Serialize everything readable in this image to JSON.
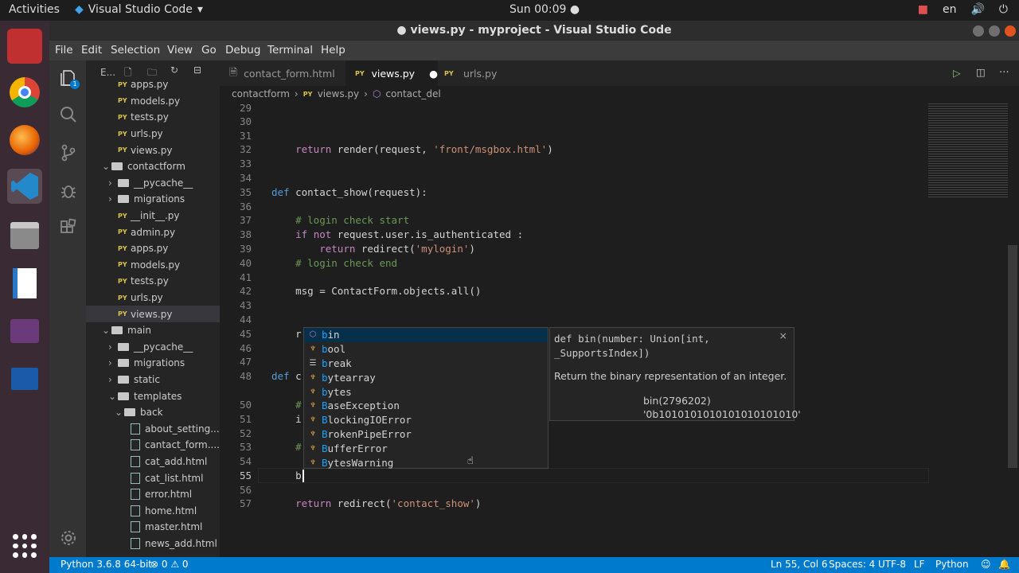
{
  "topbar": {
    "activities": "Activities",
    "app": "Visual Studio Code",
    "clock": "Sun 00:09",
    "lang": "en"
  },
  "window": {
    "title": "● views.py - myproject - Visual Studio Code"
  },
  "menu": [
    "File",
    "Edit",
    "Selection",
    "View",
    "Go",
    "Debug",
    "Terminal",
    "Help"
  ],
  "explorer": {
    "label": "E..."
  },
  "tree": [
    {
      "name": "apps.py",
      "kind": "py",
      "indent": 40
    },
    {
      "name": "models.py",
      "kind": "py",
      "indent": 40
    },
    {
      "name": "tests.py",
      "kind": "py",
      "indent": 40
    },
    {
      "name": "urls.py",
      "kind": "py",
      "indent": 40
    },
    {
      "name": "views.py",
      "kind": "py",
      "indent": 40
    },
    {
      "name": "contactform",
      "kind": "folder-open",
      "indent": 20
    },
    {
      "name": "__pycache__",
      "kind": "folder",
      "indent": 28
    },
    {
      "name": "migrations",
      "kind": "folder",
      "indent": 28
    },
    {
      "name": "__init__.py",
      "kind": "py",
      "indent": 40
    },
    {
      "name": "admin.py",
      "kind": "py",
      "indent": 40
    },
    {
      "name": "apps.py",
      "kind": "py",
      "indent": 40
    },
    {
      "name": "models.py",
      "kind": "py",
      "indent": 40
    },
    {
      "name": "tests.py",
      "kind": "py",
      "indent": 40
    },
    {
      "name": "urls.py",
      "kind": "py",
      "indent": 40
    },
    {
      "name": "views.py",
      "kind": "py",
      "indent": 40,
      "selected": true
    },
    {
      "name": "main",
      "kind": "folder-open",
      "indent": 20
    },
    {
      "name": "__pycache__",
      "kind": "folder",
      "indent": 28
    },
    {
      "name": "migrations",
      "kind": "folder",
      "indent": 28
    },
    {
      "name": "static",
      "kind": "folder",
      "indent": 28
    },
    {
      "name": "templates",
      "kind": "folder-open",
      "indent": 28
    },
    {
      "name": "back",
      "kind": "folder-open",
      "indent": 36
    },
    {
      "name": "about_setting...",
      "kind": "html",
      "indent": 56
    },
    {
      "name": "cantact_form....",
      "kind": "html",
      "indent": 56
    },
    {
      "name": "cat_add.html",
      "kind": "html",
      "indent": 56
    },
    {
      "name": "cat_list.html",
      "kind": "html",
      "indent": 56
    },
    {
      "name": "error.html",
      "kind": "html",
      "indent": 56
    },
    {
      "name": "home.html",
      "kind": "html",
      "indent": 56
    },
    {
      "name": "master.html",
      "kind": "html",
      "indent": 56
    },
    {
      "name": "news_add.html",
      "kind": "html",
      "indent": 56
    }
  ],
  "tabs": [
    {
      "label": "contact_form.html",
      "icon": "html-file-icon",
      "active": false
    },
    {
      "label": "views.py",
      "icon": "PY",
      "active": true,
      "dirty": "●"
    },
    {
      "label": "urls.py",
      "icon": "PY",
      "active": false
    }
  ],
  "breadcrumbs": {
    "folder": "contactform",
    "file": "views.py",
    "symbol": "contact_del"
  },
  "code": [
    {
      "n": "29",
      "t": ""
    },
    {
      "n": "30",
      "t": ""
    },
    {
      "n": "31",
      "t": ""
    },
    {
      "n": "32",
      "t": "    return render(request, 'front/msgbox.html')"
    },
    {
      "n": "33",
      "t": ""
    },
    {
      "n": "34",
      "t": ""
    },
    {
      "n": "35",
      "t": "def contact_show(request):"
    },
    {
      "n": "36",
      "t": ""
    },
    {
      "n": "37",
      "t": "    # login check start"
    },
    {
      "n": "38",
      "t": "    if not request.user.is_authenticated :"
    },
    {
      "n": "39",
      "t": "        return redirect('mylogin')"
    },
    {
      "n": "40",
      "t": "    # login check end"
    },
    {
      "n": "41",
      "t": ""
    },
    {
      "n": "42",
      "t": "    msg = ContactForm.objects.all()"
    },
    {
      "n": "43",
      "t": ""
    },
    {
      "n": "44",
      "t": ""
    },
    {
      "n": "45",
      "t": "    r"
    },
    {
      "n": "46",
      "t": ""
    },
    {
      "n": "47",
      "t": ""
    },
    {
      "n": "48",
      "t": "def c"
    },
    {
      "n": "50",
      "t": "    #"
    },
    {
      "n": "51",
      "t": "    i"
    },
    {
      "n": "52",
      "t": ""
    },
    {
      "n": "53",
      "t": "    #"
    },
    {
      "n": "54",
      "t": ""
    },
    {
      "n": "55",
      "t": "    b"
    },
    {
      "n": "56",
      "t": ""
    },
    {
      "n": "57",
      "t": "    return redirect('contact_show')"
    }
  ],
  "suggestions": [
    {
      "text": "bin",
      "icon": "cube"
    },
    {
      "text": "bool",
      "icon": "class"
    },
    {
      "text": "break",
      "icon": "keyword"
    },
    {
      "text": "bytearray",
      "icon": "class"
    },
    {
      "text": "bytes",
      "icon": "class"
    },
    {
      "text": "BaseException",
      "icon": "class"
    },
    {
      "text": "BlockingIOError",
      "icon": "class"
    },
    {
      "text": "BrokenPipeError",
      "icon": "class"
    },
    {
      "text": "BufferError",
      "icon": "class"
    },
    {
      "text": "BytesWarning",
      "icon": "class"
    }
  ],
  "docs": {
    "signature": "def bin(number: Union[int, _SupportsIndex])",
    "description": "Return the binary representation of an integer.",
    "example1": "bin(2796202)",
    "example2": "'0b1010101010101010101010'",
    "close": "×"
  },
  "status": {
    "python": "Python 3.6.8 64-bit",
    "problems": "⊗ 0 ⚠ 0",
    "position": "Ln 55, Col 6",
    "spaces": "Spaces: 4",
    "encoding": "UTF-8",
    "eol": "LF",
    "language": "Python"
  },
  "colors": {
    "status": "#007acc",
    "editor": "#1e1e1e",
    "sidebar": "#252526"
  }
}
